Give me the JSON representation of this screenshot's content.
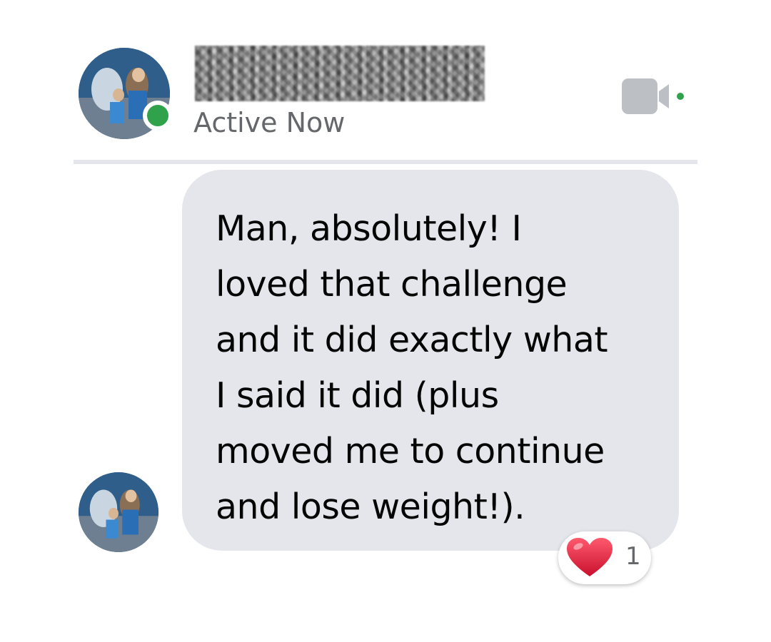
{
  "header": {
    "status": "Active Now",
    "presence": "online",
    "video_call_icon": "video-camera-icon"
  },
  "message": {
    "text": "Man, absolutely! I\nloved that challenge\nand it did exactly what\nI said it did (plus\nmoved me to continue\nand lose weight!).",
    "reaction": {
      "icon": "heart-icon",
      "count": "1"
    }
  },
  "colors": {
    "presence": "#31a24c",
    "bubble": "#e4e6eb",
    "status_text": "#65676b",
    "heart": "#e0245e"
  }
}
